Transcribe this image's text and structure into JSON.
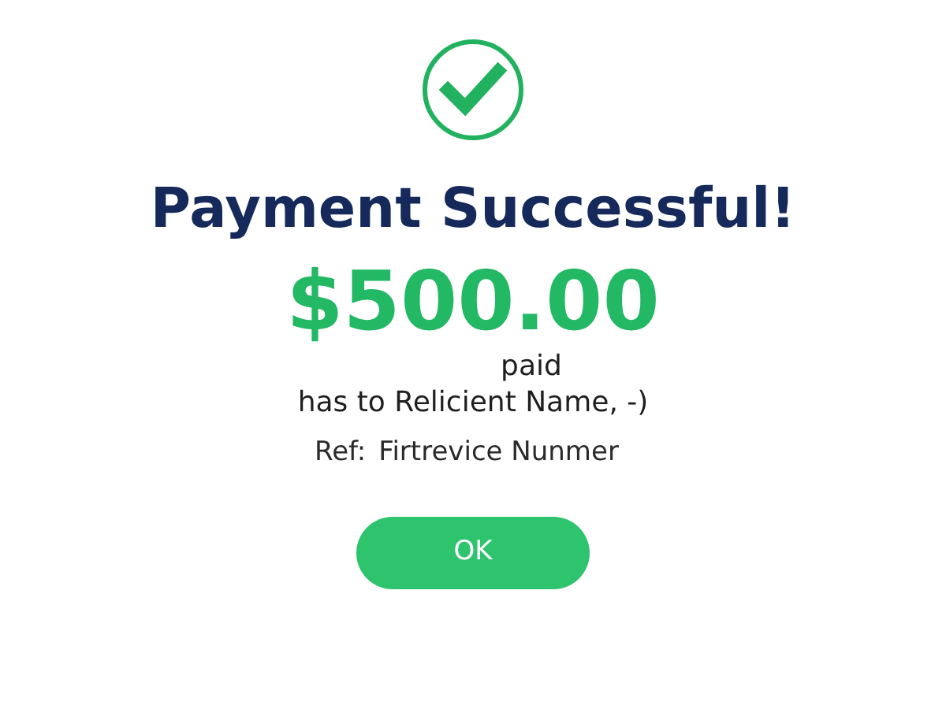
{
  "title": "Payment Successful!",
  "amount": "$500.00",
  "paid_label": "paid",
  "recipient_line": "has to Relicient Name, -)",
  "reference": {
    "label": "Ref:",
    "value": "Firtrevice Nunmer"
  },
  "button": "OK"
}
